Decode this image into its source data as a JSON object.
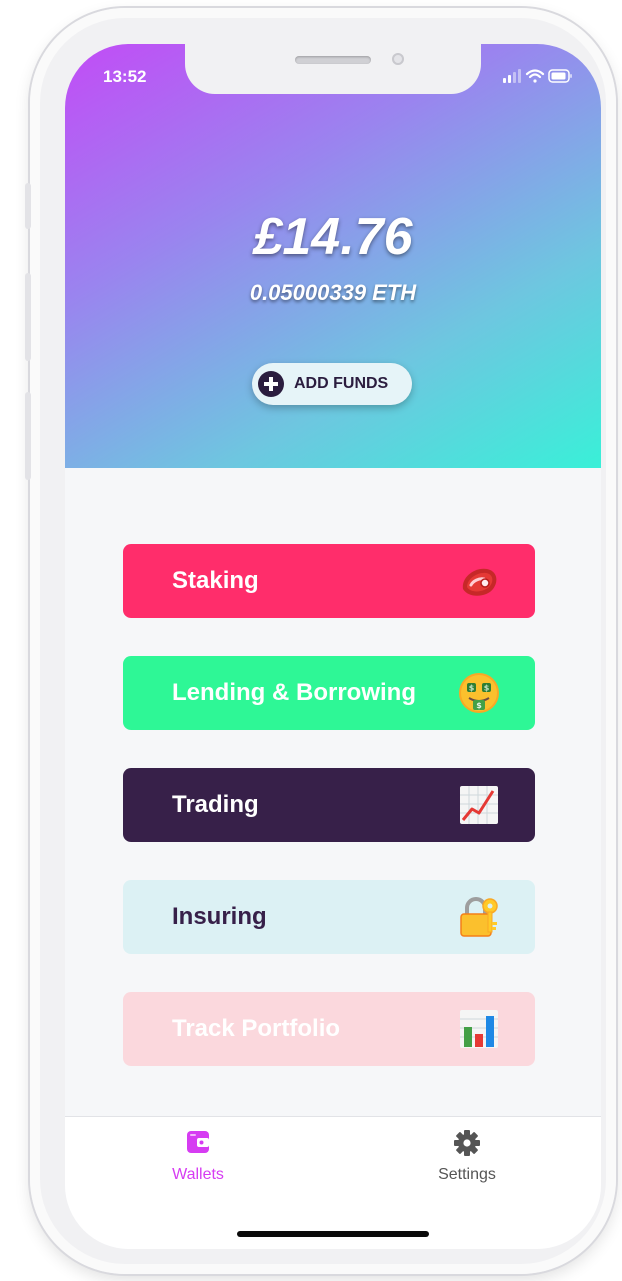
{
  "status_bar": {
    "time": "13:52"
  },
  "wallet": {
    "balance": "£14.76",
    "eth_amount": "0.05000339 ETH",
    "add_funds_label": "ADD FUNDS"
  },
  "menu": [
    {
      "label": "Staking",
      "icon": "steak-icon",
      "bg": "#ff2d6b",
      "fg": "#ffffff"
    },
    {
      "label": "Lending & Borrowing",
      "icon": "money-mouth-face-icon",
      "bg": "#2ef796",
      "fg": "#ffffff"
    },
    {
      "label": "Trading",
      "icon": "chart-increasing-icon",
      "bg": "#372049",
      "fg": "#ffffff"
    },
    {
      "label": "Insuring",
      "icon": "locked-with-key-icon",
      "bg": "#dcf1f4",
      "fg": "#372049"
    },
    {
      "label": "Track Portfolio",
      "icon": "bar-chart-icon",
      "bg": "#fbd8dd",
      "fg": "#ffffff"
    }
  ],
  "tabs": [
    {
      "label": "Wallets",
      "icon": "wallet-icon",
      "active": true,
      "color": "#d63cf2"
    },
    {
      "label": "Settings",
      "icon": "gear-icon",
      "active": false,
      "color": "#555555"
    }
  ]
}
